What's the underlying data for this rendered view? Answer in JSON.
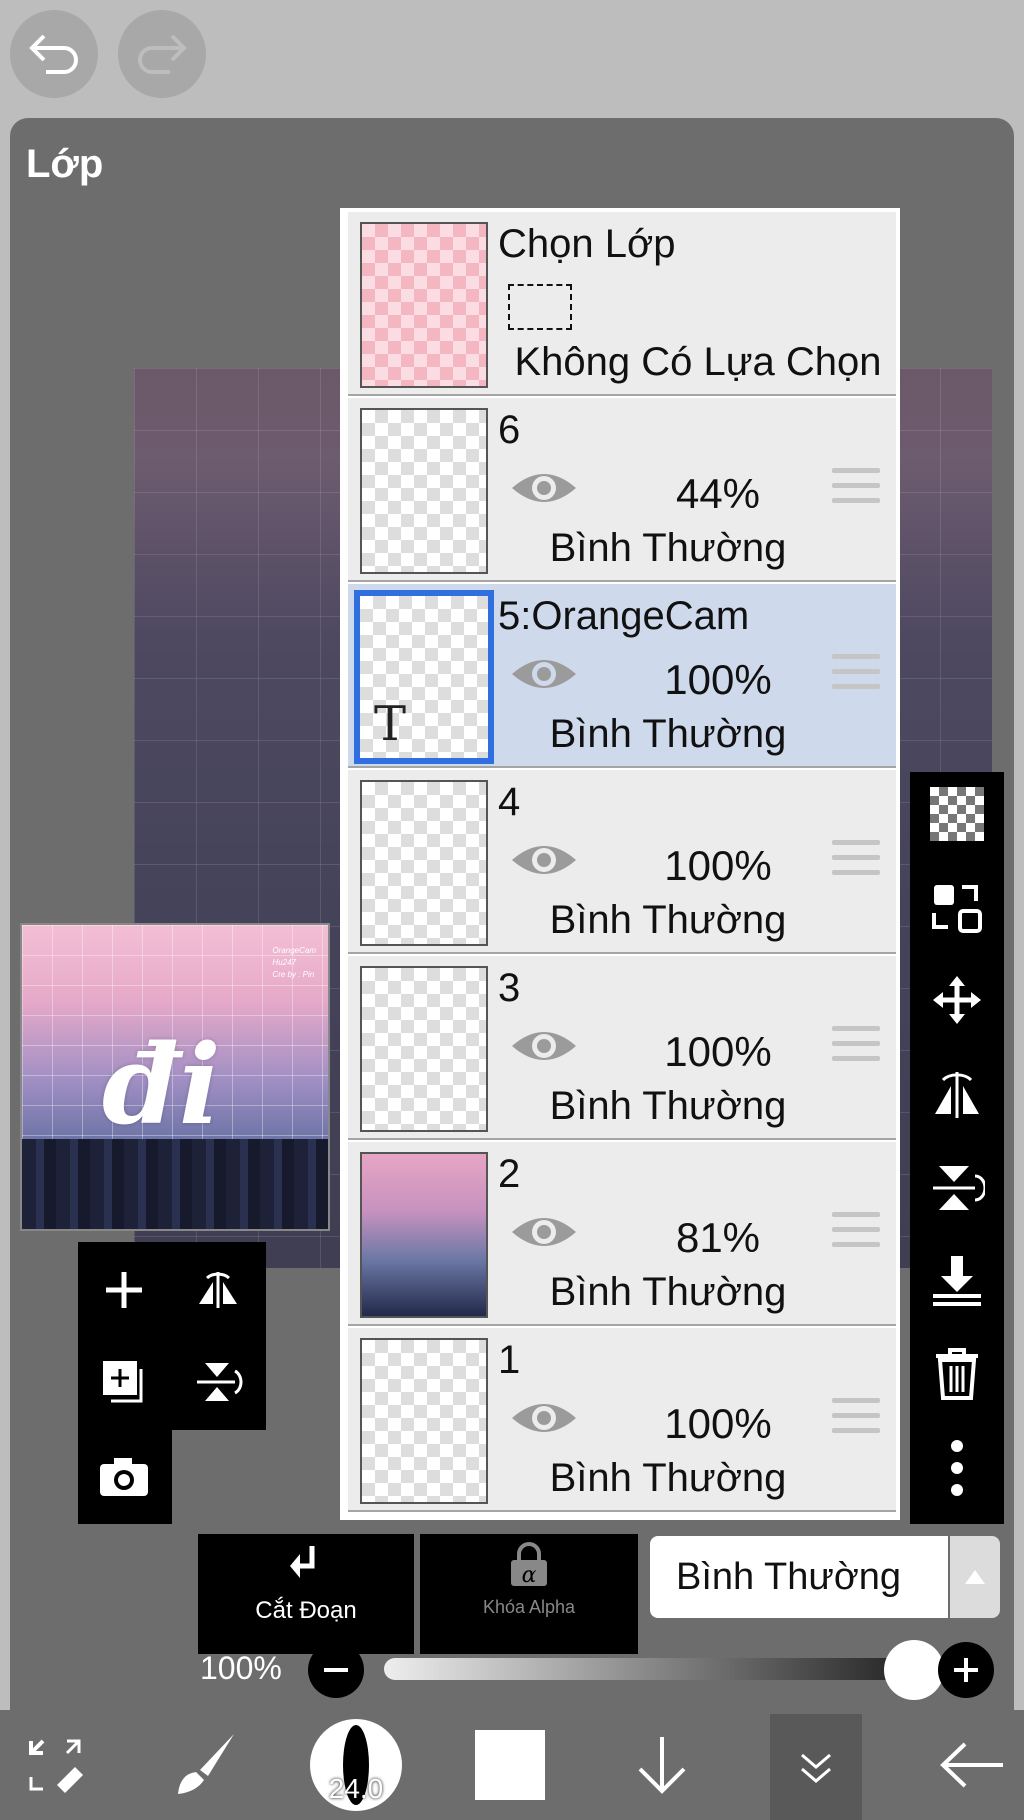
{
  "topbar": {
    "undo_icon": "undo-icon",
    "redo_icon": "redo-icon"
  },
  "panel": {
    "title": "Lớp"
  },
  "preview": {
    "art_text": "đi",
    "credit_lines": [
      "OrangeCam",
      "Hu247",
      "Cre by : Pin"
    ]
  },
  "layers": [
    {
      "id": "select",
      "name": "Chọn Lớp",
      "status": "Không Có Lựa Chọn"
    },
    {
      "id": "6",
      "name": "6",
      "opacity": "44%",
      "blend": "Bình Thường",
      "visible": true
    },
    {
      "id": "5",
      "name": "5:OrangeCam",
      "opacity": "100%",
      "blend": "Bình Thường",
      "visible": true,
      "selected": true,
      "text_mark": "T"
    },
    {
      "id": "4",
      "name": "4",
      "opacity": "100%",
      "blend": "Bình Thường",
      "visible": true
    },
    {
      "id": "3",
      "name": "3",
      "opacity": "100%",
      "blend": "Bình Thường",
      "visible": true
    },
    {
      "id": "2",
      "name": "2",
      "opacity": "81%",
      "blend": "Bình Thường",
      "visible": true
    },
    {
      "id": "1",
      "name": "1",
      "opacity": "100%",
      "blend": "Bình Thường",
      "visible": true
    }
  ],
  "bottom": {
    "clip_label": "Cắt Đoạn",
    "alpha_lock_label": "Khóa Alpha",
    "blend_mode": "Bình Thường",
    "opacity_label": "100%",
    "opacity_value": 1.0
  },
  "toolbar": {
    "brush_size": "24.0"
  },
  "colors": {
    "panel": "#6d6d6d",
    "selected_layer": "#cfd9ec",
    "selection_border": "#2f6fe0",
    "topbar": "#bdbdbd"
  }
}
